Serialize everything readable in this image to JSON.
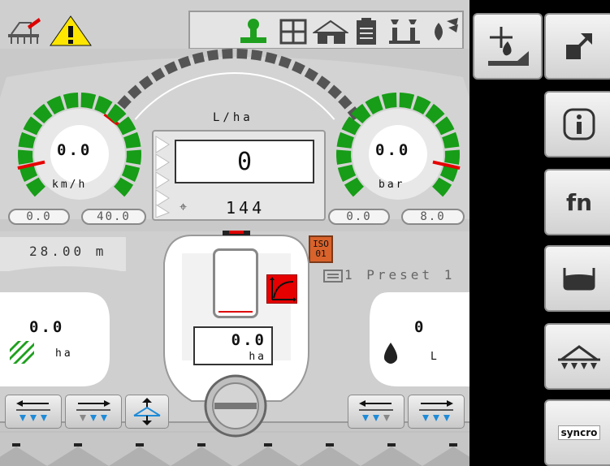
{
  "top_bar": {
    "icons": [
      "sprayer-settings-icon",
      "warning-icon",
      "operator-green-icon",
      "grid-icon",
      "barn-icon",
      "clipboard-icon",
      "nozzles-icon",
      "liquid-spray-icon"
    ]
  },
  "rate_panel": {
    "unit_label": "L/ha",
    "rate_value": "0",
    "rate_target_value": "144"
  },
  "speed_gauge": {
    "value": "0.0",
    "unit": "km/h",
    "min_label": "0.0",
    "max_label": "40.0",
    "level": 0.12
  },
  "pressure_gauge": {
    "value": "0.0",
    "unit": "bar",
    "min_label": "0.0",
    "max_label": "8.0",
    "level": 0.88
  },
  "boom": {
    "width_label": "28.00 m"
  },
  "iso_badge": {
    "line1": "ISO",
    "line2": "01"
  },
  "preset": {
    "label": "1 Preset 1"
  },
  "area_left": {
    "value": "0.0",
    "unit": "ha"
  },
  "volume_right": {
    "value": "0",
    "unit": "L"
  },
  "center_counter": {
    "value": "0.0",
    "unit": "ha"
  },
  "right_buttons": {
    "syncro_label": "syncro"
  },
  "colors": {
    "background": "#cfcfcf",
    "gauge_green": "#179d17",
    "warning_yellow": "#ffe600",
    "iso_orange": "#d9632b",
    "curve_red": "#e60000",
    "nozzle_blue": "#1f8bd8"
  }
}
